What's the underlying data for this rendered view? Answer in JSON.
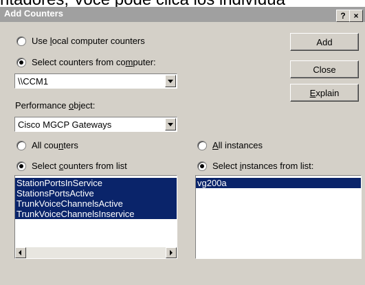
{
  "background_caption": {
    "text": "ntadores, Você pode clica los indivídua"
  },
  "window": {
    "title": "Add Counters",
    "help_glyph": "?",
    "close_glyph": "×"
  },
  "source": {
    "local_option": {
      "pre": "Use ",
      "ul": "l",
      "post": "ocal computer counters",
      "selected": false
    },
    "computer_option": {
      "pre": "Select counters from co",
      "ul": "m",
      "post": "puter:",
      "selected": true
    },
    "computer_value": "\\\\CCM1"
  },
  "object": {
    "label_pre": "Performance ",
    "label_ul": "o",
    "label_post": "bject:",
    "value": "Cisco MGCP Gateways"
  },
  "counters": {
    "all_option": {
      "pre": "All cou",
      "ul": "n",
      "post": "ters",
      "selected": false
    },
    "list_option": {
      "pre": "Select ",
      "ul": "c",
      "post": "ounters from list",
      "selected": true
    },
    "items": [
      "StationPortsInService",
      "StationsPortsActive",
      "TrunkVoiceChannelsActive",
      "TrunkVoiceChannelsInservice"
    ]
  },
  "instances": {
    "all_option": {
      "pre": "",
      "ul": "A",
      "post": "ll instances",
      "selected": false
    },
    "list_option": {
      "pre": "Select ",
      "ul": "i",
      "post": "nstances from list:",
      "selected": true
    },
    "items": [
      "vg200a"
    ]
  },
  "buttons": {
    "add": "Add",
    "close": "Close",
    "explain_ul": "E",
    "explain_post": "xplain"
  },
  "colors": {
    "title_bar": "#a0a0a0",
    "dialog_face": "#d4d0c8",
    "selection": "#0a246a"
  }
}
